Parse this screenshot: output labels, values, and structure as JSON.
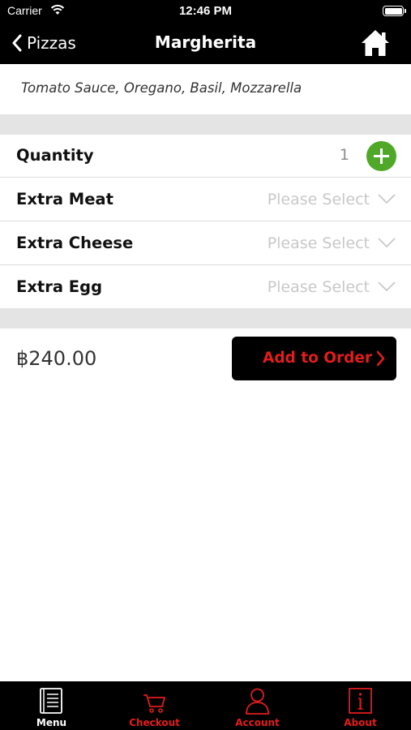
{
  "status_bar": {
    "carrier": "Carrier",
    "time": "12:46 PM"
  },
  "nav": {
    "back_label": "Pizzas",
    "title": "Margherita"
  },
  "description": "Tomato Sauce, Oregano, Basil, Mozzarella",
  "options": {
    "quantity_label": "Quantity",
    "quantity_value": "1",
    "extra_meat_label": "Extra Meat",
    "extra_cheese_label": "Extra Cheese",
    "extra_egg_label": "Extra Egg",
    "placeholder": "Please Select"
  },
  "order": {
    "price": "฿240.00",
    "add_label": "Add to Order"
  },
  "tabs": [
    {
      "label": "Menu",
      "icon": "menu-book-icon",
      "color": "#ffffff",
      "active": true
    },
    {
      "label": "Checkout",
      "icon": "cart-icon",
      "color": "#e31c1c"
    },
    {
      "label": "Account",
      "icon": "person-icon",
      "color": "#e31c1c"
    },
    {
      "label": "About",
      "icon": "info-icon",
      "color": "#e31c1c"
    }
  ],
  "colors": {
    "accent_red": "#e31c1c",
    "plus_green": "#4fa828",
    "bar_black": "#000000"
  }
}
